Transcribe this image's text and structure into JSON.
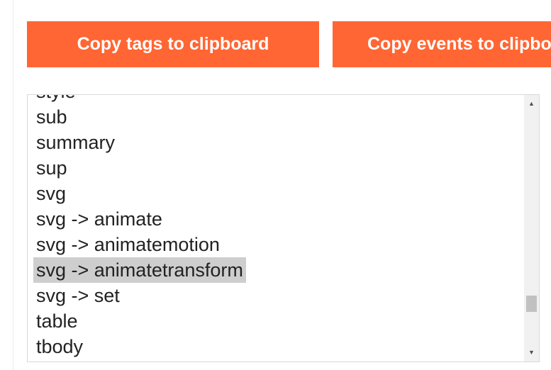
{
  "buttons": {
    "copy_tags_label": "Copy tags to clipboard",
    "copy_events_label": "Copy events to clipbo"
  },
  "tag_list": {
    "items": [
      "style",
      "sub",
      "summary",
      "sup",
      "svg",
      "svg -> animate",
      "svg -> animatemotion",
      "svg -> animatetransform",
      "svg -> set",
      "table",
      "tbody"
    ],
    "selected": "svg -> animatetransform",
    "scroll_position": 0.85
  },
  "scrollbar": {
    "up_arrow": "▲",
    "down_arrow": "▼"
  },
  "colors": {
    "button_background": "#ff6633",
    "button_text": "#ffffff",
    "selection_background": "#cecece"
  },
  "icons": {
    "scroll_up": "caret-up-icon",
    "scroll_down": "caret-down-icon"
  }
}
